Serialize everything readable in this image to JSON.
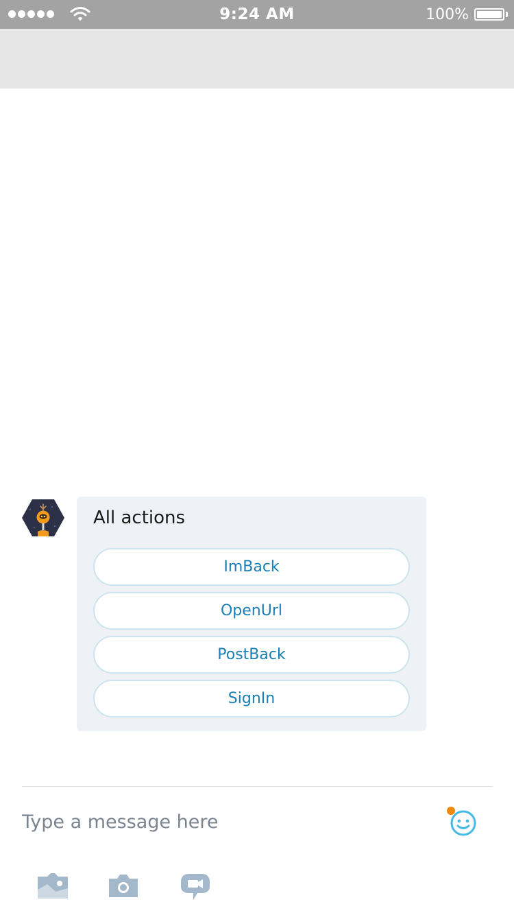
{
  "status_bar": {
    "time": "9:24 AM",
    "battery_percent": "100%",
    "signal_bars": 5,
    "battery_level": 1.0
  },
  "message": {
    "card_title": "All actions",
    "actions": [
      "ImBack",
      "OpenUrl",
      "PostBack",
      "SignIn"
    ]
  },
  "composer": {
    "placeholder": "Type a message here",
    "value": ""
  },
  "toolbar_icons": [
    "gallery-icon",
    "camera-icon",
    "video-message-icon"
  ],
  "colors": {
    "status_bar_bg": "#a3a3a3",
    "header_bg": "#e6e6e6",
    "card_bg": "#eef2f7",
    "button_text": "#1a7fb5",
    "button_border": "#cce4ee",
    "icon_gray": "#a4b8cc",
    "emoji_blue": "#45b8e8",
    "notification_orange": "#f0890e"
  }
}
